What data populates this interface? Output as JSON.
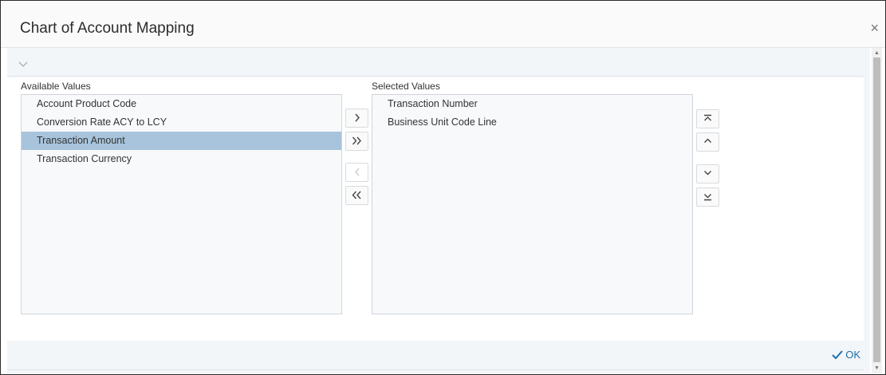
{
  "dialog": {
    "title": "Chart of Account Mapping",
    "close_glyph": "×"
  },
  "available": {
    "label": "Available Values",
    "items": [
      {
        "label": "Account Product Code"
      },
      {
        "label": "Conversion Rate ACY to LCY"
      },
      {
        "label": "Transaction Amount",
        "selected": true
      },
      {
        "label": "Transaction Currency"
      }
    ]
  },
  "selected": {
    "label": "Selected Values",
    "items": [
      {
        "label": "Transaction Number"
      },
      {
        "label": "Business Unit Code Line"
      }
    ]
  },
  "footer": {
    "ok_label": "OK",
    "ok_icon": "checkmark-icon"
  },
  "colors": {
    "selected_row": "#a7c4dc",
    "ok_text": "#1d6fa8"
  }
}
